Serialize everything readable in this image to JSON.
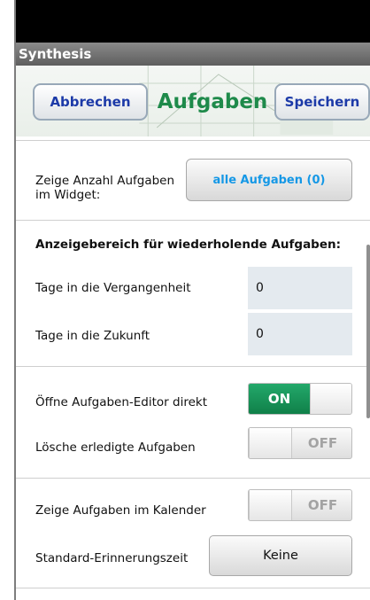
{
  "app": {
    "title": "Synthesis"
  },
  "header": {
    "cancel_label": "Abbrechen",
    "title": "Aufgaben",
    "save_label": "Speichern"
  },
  "widget": {
    "label": "Zeige Anzahl Aufgaben im Widget:",
    "button_label": "alle Aufgaben  (0)"
  },
  "repeat": {
    "heading": "Anzeigebereich für wiederholende Aufgaben:",
    "past_label": "Tage in die Vergangenheit",
    "past_value": "0",
    "future_label": "Tage in die Zukunft",
    "future_value": "0"
  },
  "editor": {
    "label": "Öffne Aufgaben-Editor direkt",
    "state": "on",
    "on_text": "ON"
  },
  "delete_done": {
    "label": "Lösche erledigte Aufgaben",
    "state": "off",
    "off_text": "OFF"
  },
  "calendar": {
    "label": "Zeige Aufgaben im Kalender",
    "state": "off",
    "off_text": "OFF"
  },
  "reminder": {
    "label": "Standard-Erinnerungszeit",
    "button_label": "Keine"
  },
  "colors": {
    "title_green": "#1e8a4a",
    "button_blue": "#1c3aa8",
    "link_blue": "#1598e6",
    "toggle_on": "#108049"
  }
}
